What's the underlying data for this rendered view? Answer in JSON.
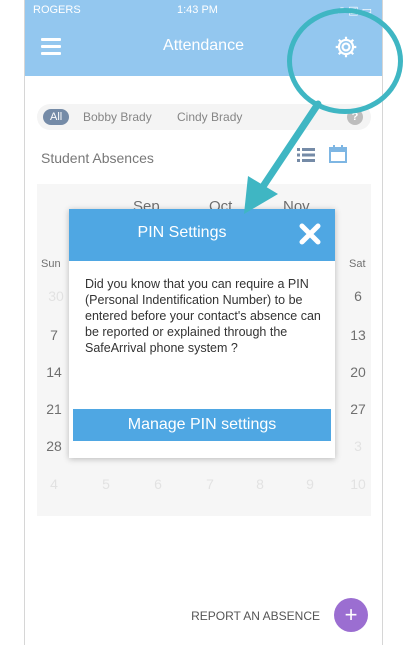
{
  "status_bar": {
    "carrier": "ROGERS",
    "time": "1:43 PM",
    "icons": "↗ ▣ ▭"
  },
  "navbar": {
    "title": "Attendance"
  },
  "filters": {
    "all": "All",
    "students": [
      "Bobby Brady",
      "Cindy Brady"
    ],
    "help": "?"
  },
  "section": {
    "title": "Student Absences"
  },
  "calendar": {
    "months": [
      "Sep",
      "Oct",
      "Nov"
    ],
    "weekdays": [
      "Sun",
      "",
      "",
      "",
      "",
      "",
      "Sat"
    ],
    "rows": [
      [
        "30",
        "",
        "",
        "",
        "",
        "",
        "6"
      ],
      [
        "7",
        "",
        "",
        "",
        "",
        "",
        "13"
      ],
      [
        "14",
        "",
        "",
        "",
        "",
        "",
        "20"
      ],
      [
        "21",
        "",
        "",
        "",
        "",
        "",
        "27"
      ],
      [
        "28",
        "",
        "",
        "",
        "",
        "",
        "3"
      ],
      [
        "4",
        "5",
        "6",
        "7",
        "8",
        "9",
        "10"
      ]
    ]
  },
  "modal": {
    "title": "PIN Settings",
    "body": "Did you know that you can require a PIN (Personal Indentification Number) to be entered before your contact's absence can be reported or explained through the SafeArrival phone system ?",
    "button": "Manage PIN settings"
  },
  "bottom": {
    "report_label": "REPORT AN ABSENCE",
    "fab": "+"
  },
  "colors": {
    "header": "#5aa9e6",
    "modal_header": "#4fa7e3",
    "chip": "#2c4d78",
    "fab": "#9b6ed1",
    "callout": "#3fb6c3"
  },
  "icons": [
    "menu-icon",
    "gear-icon",
    "help-icon",
    "list-icon",
    "calendar-icon",
    "close-icon",
    "plus-icon"
  ]
}
